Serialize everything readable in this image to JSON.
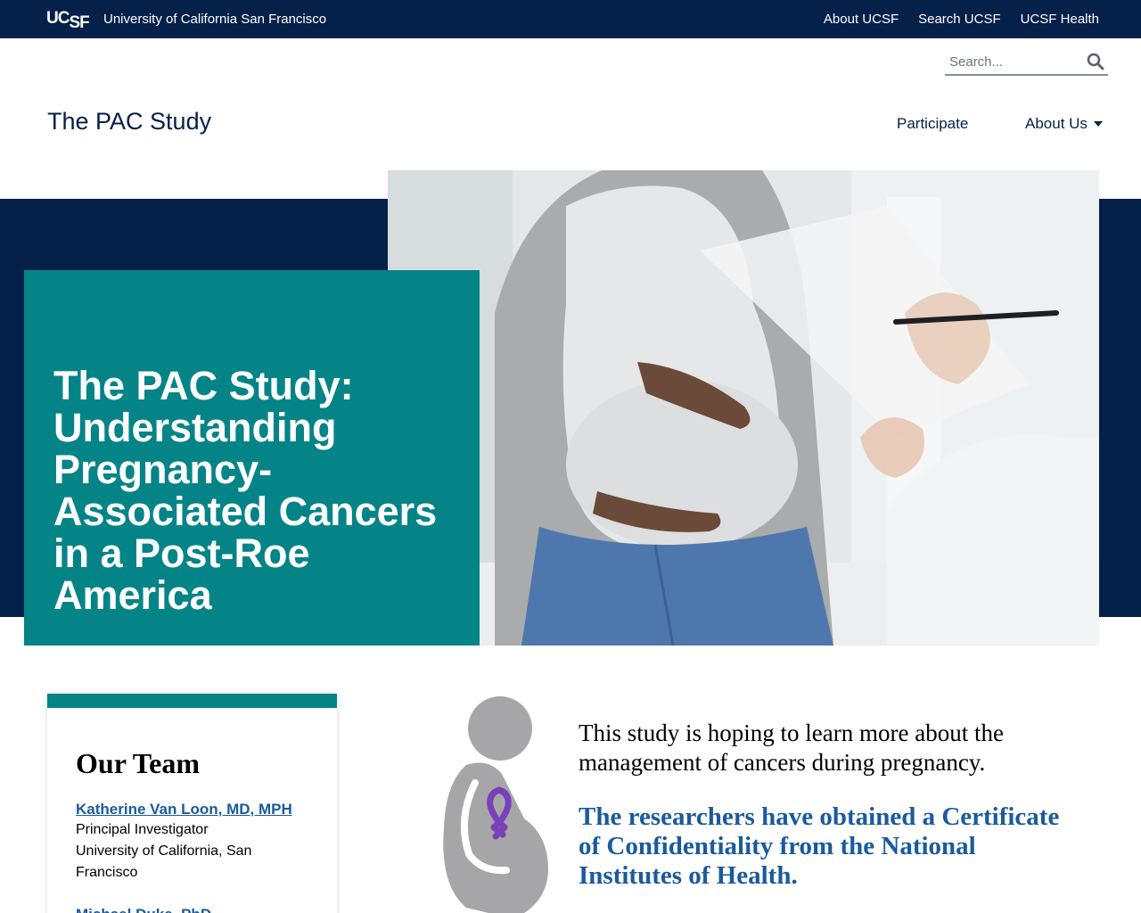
{
  "topbar": {
    "logo": "UCSF",
    "university": "University of California San Francisco",
    "links": [
      "About UCSF",
      "Search UCSF",
      "UCSF Health"
    ]
  },
  "search": {
    "placeholder": "Search..."
  },
  "site": {
    "title": "The PAC Study"
  },
  "nav": {
    "participate": "Participate",
    "about": "About Us"
  },
  "hero": {
    "title": "The PAC Study: Understanding Pregnancy-Associated Cancers in a Post-Roe America"
  },
  "team": {
    "heading": "Our Team",
    "members": [
      {
        "name": "Katherine Van Loon, MD, MPH",
        "role": "Principal Investigator",
        "affiliation": "University of California, San Francisco"
      },
      {
        "name": "Michael Duke, PhD"
      }
    ]
  },
  "intro": {
    "text": "This study is hoping to learn more about the management of cancers during pregnancy.",
    "highlight": "The researchers have obtained a Certificate of Confidentiality from the National Institutes of Health."
  },
  "colors": {
    "navy": "#052049",
    "teal": "#058488",
    "link_blue": "#1a5a9e",
    "ribbon": "#7b3fb8"
  }
}
